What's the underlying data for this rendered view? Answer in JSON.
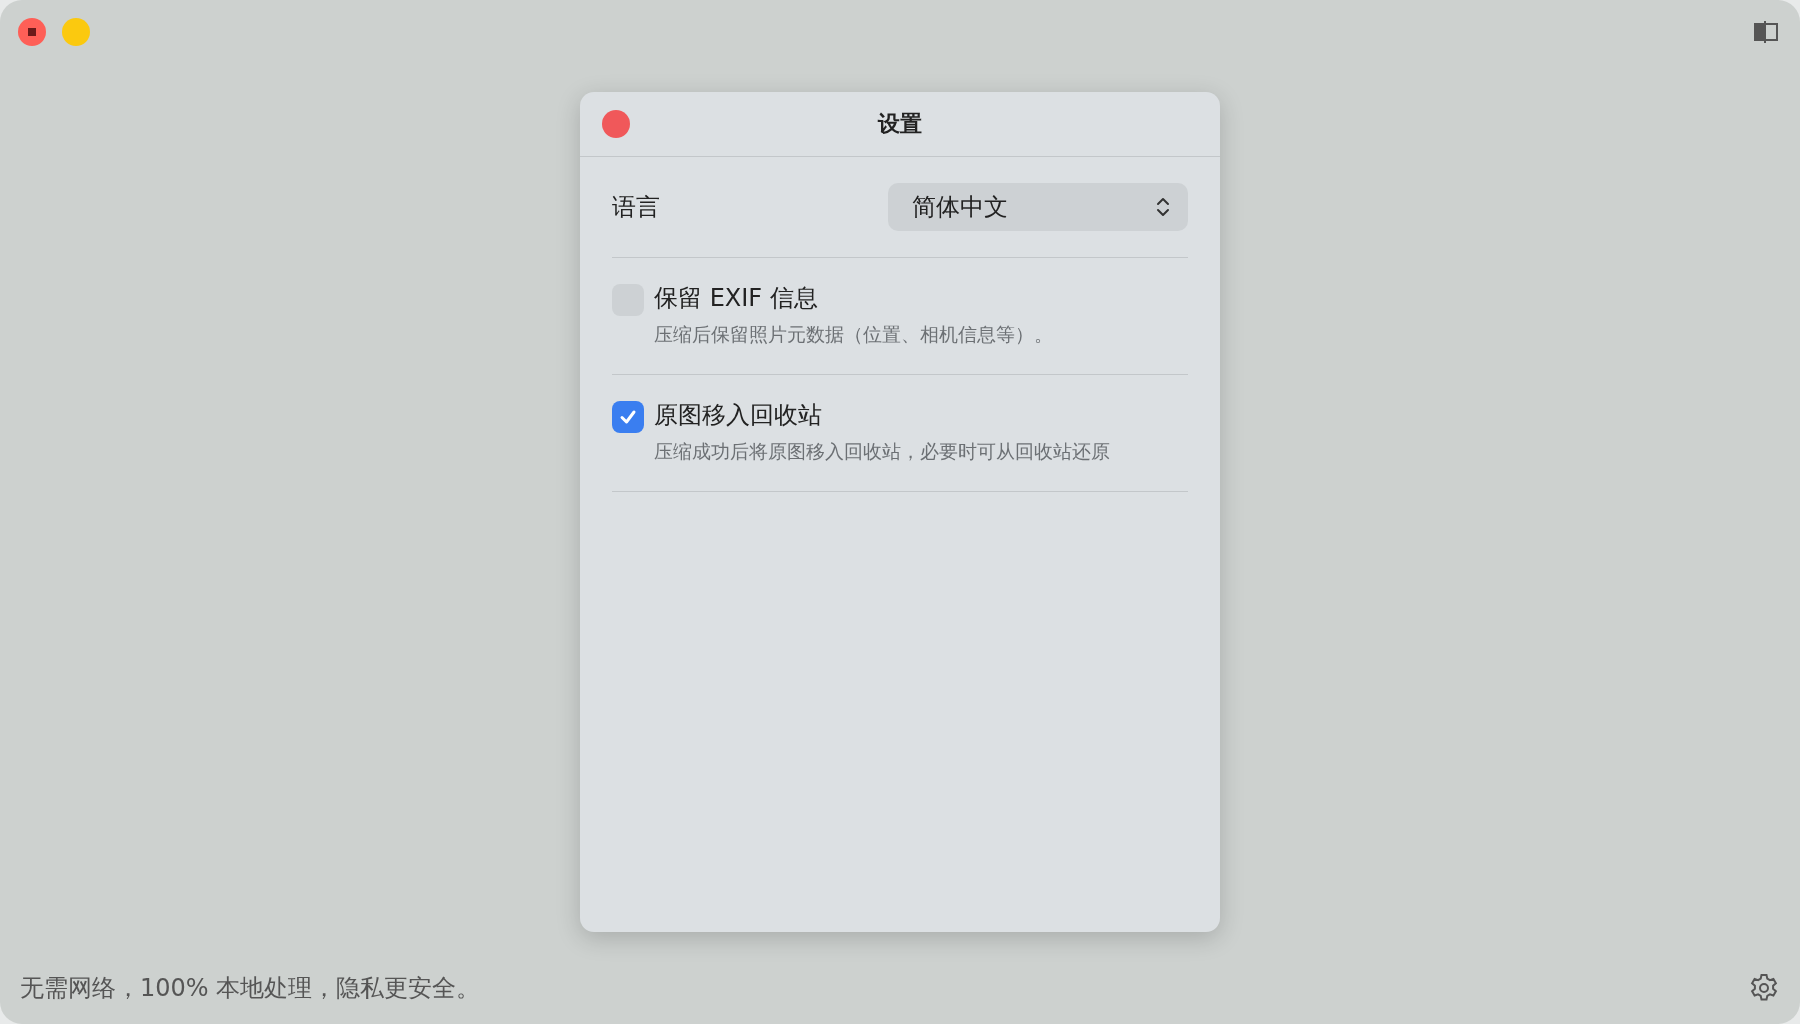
{
  "window": {
    "close": {
      "kind": "close"
    },
    "minimize": {
      "kind": "minimize"
    }
  },
  "dialog": {
    "title": "设置",
    "language": {
      "label": "语言",
      "value": "简体中文"
    },
    "options": [
      {
        "label": "保留 EXIF 信息",
        "description": "压缩后保留照片元数据（位置、相机信息等）。",
        "checked": false
      },
      {
        "label": "原图移入回收站",
        "description": "压缩成功后将原图移入回收站，必要时可从回收站还原",
        "checked": true
      }
    ]
  },
  "status_bar": {
    "text": "无需网络，100% 本地处理，隐私更安全。"
  }
}
